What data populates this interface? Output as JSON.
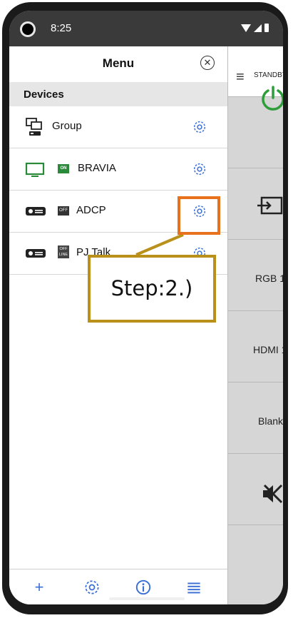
{
  "status_bar": {
    "time": "8:25"
  },
  "drawer": {
    "title": "Menu",
    "section": "Devices",
    "devices": [
      {
        "name": "Group",
        "status": ""
      },
      {
        "name": "BRAVIA",
        "status": "ON"
      },
      {
        "name": "ADCP",
        "status": "OFF"
      },
      {
        "name": "PJ Talk",
        "status_top": "OFF",
        "status_bottom": "LINE"
      }
    ]
  },
  "annotation": {
    "text": "Step:2.)",
    "highlight_color": "#e8721c",
    "callout_color": "#b8901a"
  },
  "background_app": {
    "buttons": [
      {
        "label": "STANDBY"
      },
      {
        "label": "RGB 1"
      },
      {
        "label": "HDMI 1"
      },
      {
        "label": "Blank"
      }
    ]
  },
  "toolbar": {
    "icons": [
      "plus-icon",
      "gear-icon",
      "info-icon",
      "list-icon"
    ],
    "accent": "#3b6fd6"
  }
}
